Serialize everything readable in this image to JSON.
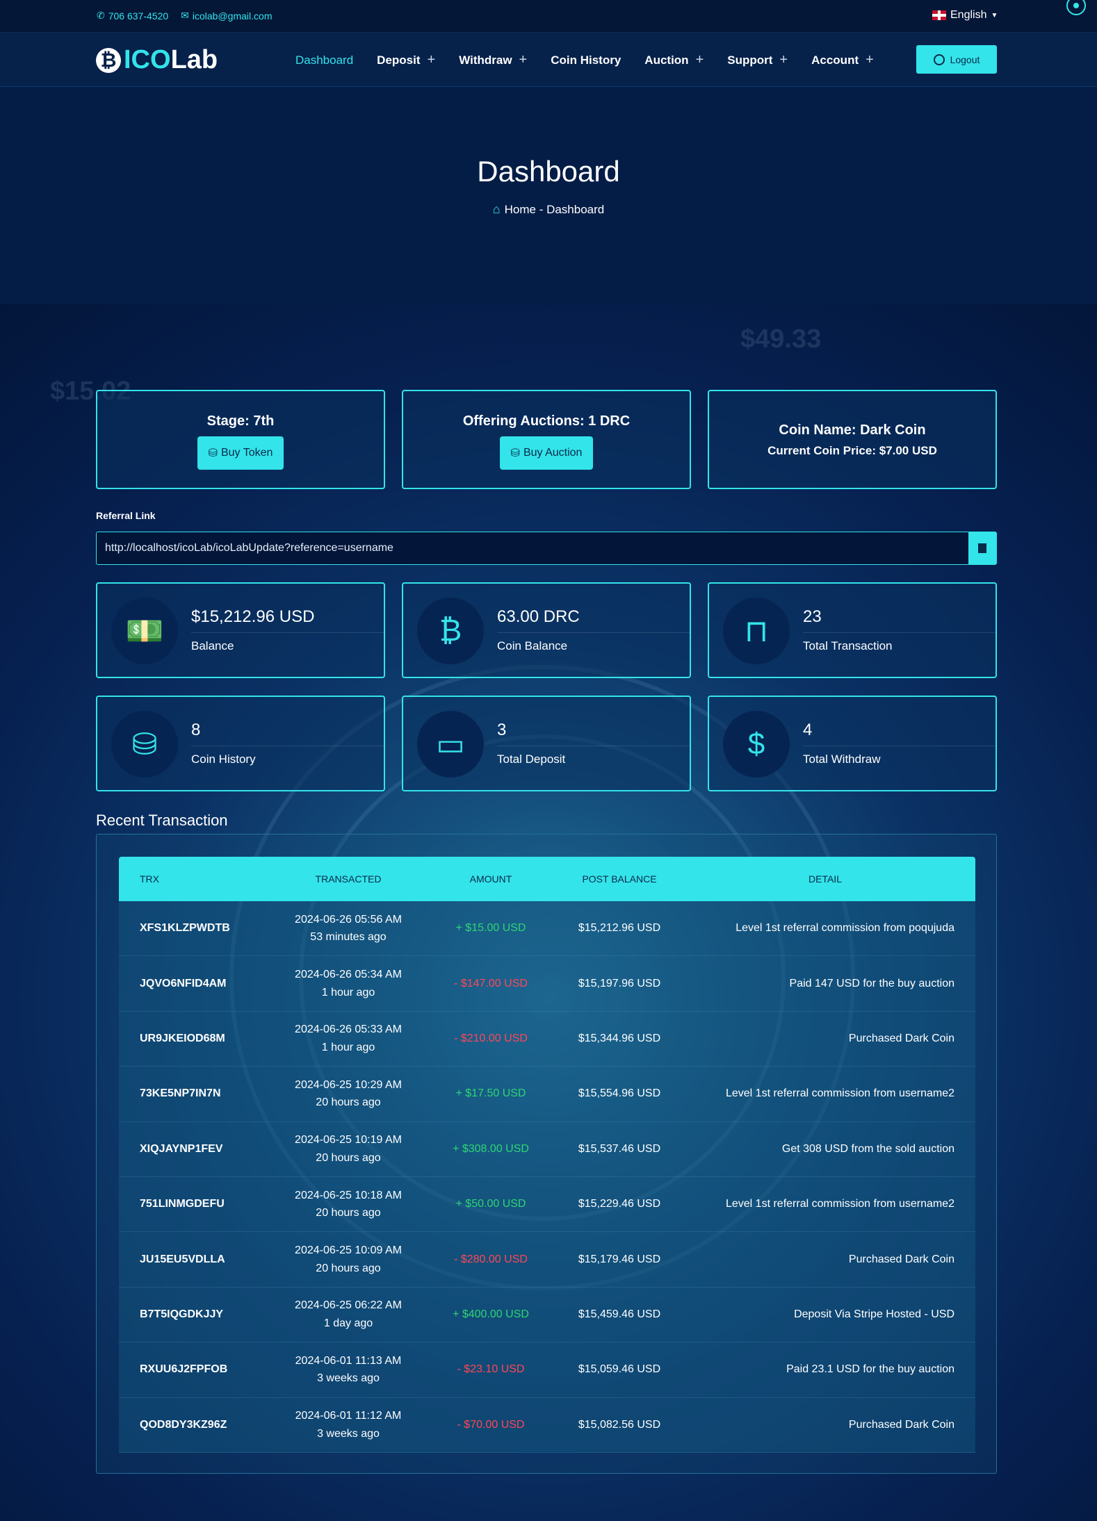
{
  "topbar": {
    "phone": "706 637-4520",
    "email": "icolab@gmail.com",
    "language": "English"
  },
  "brand": {
    "logo_text_a": "ICO",
    "logo_text_b": "Lab"
  },
  "nav": {
    "items": [
      {
        "label": "Dashboard",
        "active": true
      },
      {
        "label": "Deposit",
        "has_submenu": true
      },
      {
        "label": "Withdraw",
        "has_submenu": true
      },
      {
        "label": "Coin History"
      },
      {
        "label": "Auction",
        "has_submenu": true
      },
      {
        "label": "Support",
        "has_submenu": true
      },
      {
        "label": "Account",
        "has_submenu": true
      }
    ],
    "logout_label": "Logout"
  },
  "hero": {
    "title": "Dashboard",
    "breadcrumb": "Home - Dashboard"
  },
  "summary": {
    "stage": "Stage: 7th",
    "buy_token_label": "Buy Token",
    "offering": "Offering Auctions: 1 DRC",
    "buy_auction_label": "Buy Auction",
    "coin_name": "Coin Name: Dark Coin",
    "coin_price": "Current Coin Price: $7.00 USD"
  },
  "referral": {
    "label": "Referral Link",
    "value": "http://localhost/icoLab/icoLabUpdate?reference=username"
  },
  "stats": [
    {
      "value": "$15,212.96 USD",
      "label": "Balance",
      "icon": "money-icon"
    },
    {
      "value": "63.00 DRC",
      "label": "Coin Balance",
      "icon": "bitcoin-icon"
    },
    {
      "value": "23",
      "label": "Total Transaction",
      "icon": "book-icon"
    },
    {
      "value": "8",
      "label": "Coin History",
      "icon": "coins-icon"
    },
    {
      "value": "3",
      "label": "Total Deposit",
      "icon": "wallet-icon"
    },
    {
      "value": "4",
      "label": "Total Withdraw",
      "icon": "hand-dollar-icon"
    }
  ],
  "transactions": {
    "title": "Recent Transaction",
    "headers": [
      "TRX",
      "TRANSACTED",
      "AMOUNT",
      "POST BALANCE",
      "DETAIL"
    ],
    "rows": [
      {
        "trx": "XFS1KLZPWDTB",
        "date": "2024-06-26 05:56 AM",
        "ago": "53 minutes ago",
        "amount": "+ $15.00 USD",
        "type": "pos",
        "balance": "$15,212.96 USD",
        "detail": "Level 1st referral commission from poqujuda"
      },
      {
        "trx": "JQVO6NFID4AM",
        "date": "2024-06-26 05:34 AM",
        "ago": "1 hour ago",
        "amount": "- $147.00 USD",
        "type": "neg",
        "balance": "$15,197.96 USD",
        "detail": "Paid 147 USD for the buy auction"
      },
      {
        "trx": "UR9JKEIOD68M",
        "date": "2024-06-26 05:33 AM",
        "ago": "1 hour ago",
        "amount": "- $210.00 USD",
        "type": "neg",
        "balance": "$15,344.96 USD",
        "detail": "Purchased Dark Coin"
      },
      {
        "trx": "73KE5NP7IN7N",
        "date": "2024-06-25 10:29 AM",
        "ago": "20 hours ago",
        "amount": "+ $17.50 USD",
        "type": "pos",
        "balance": "$15,554.96 USD",
        "detail": "Level 1st referral commission from username2"
      },
      {
        "trx": "XIQJAYNP1FEV",
        "date": "2024-06-25 10:19 AM",
        "ago": "20 hours ago",
        "amount": "+ $308.00 USD",
        "type": "pos",
        "balance": "$15,537.46 USD",
        "detail": "Get 308 USD from the sold auction"
      },
      {
        "trx": "751LINMGDEFU",
        "date": "2024-06-25 10:18 AM",
        "ago": "20 hours ago",
        "amount": "+ $50.00 USD",
        "type": "pos",
        "balance": "$15,229.46 USD",
        "detail": "Level 1st referral commission from username2"
      },
      {
        "trx": "JU15EU5VDLLA",
        "date": "2024-06-25 10:09 AM",
        "ago": "20 hours ago",
        "amount": "- $280.00 USD",
        "type": "neg",
        "balance": "$15,179.46 USD",
        "detail": "Purchased Dark Coin"
      },
      {
        "trx": "B7T5IQGDKJJY",
        "date": "2024-06-25 06:22 AM",
        "ago": "1 day ago",
        "amount": "+ $400.00 USD",
        "type": "pos",
        "balance": "$15,459.46 USD",
        "detail": "Deposit Via Stripe Hosted - USD"
      },
      {
        "trx": "RXUU6J2FPFOB",
        "date": "2024-06-01 11:13 AM",
        "ago": "3 weeks ago",
        "amount": "- $23.10 USD",
        "type": "neg",
        "balance": "$15,059.46 USD",
        "detail": "Paid 23.1 USD for the buy auction"
      },
      {
        "trx": "QOD8DY3KZ96Z",
        "date": "2024-06-01 11:12 AM",
        "ago": "3 weeks ago",
        "amount": "- $70.00 USD",
        "type": "neg",
        "balance": "$15,082.56 USD",
        "detail": "Purchased Dark Coin"
      }
    ]
  },
  "colors": {
    "accent": "#33e4ea",
    "positive": "#2ed573",
    "negative": "#ff4757"
  }
}
